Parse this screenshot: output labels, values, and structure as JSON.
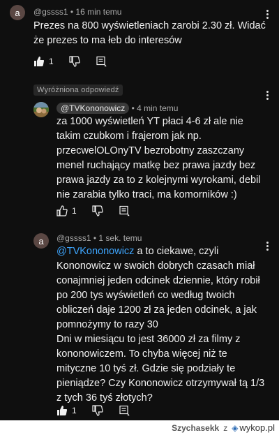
{
  "comment1": {
    "avatar_letter": "a",
    "username": "@gssss1",
    "time": "• 16 min temu",
    "lines": [
      "Prezes na 800 wyświetleniach zarobi 2.30 zł. Widać",
      "że prezes to ma łeb do interesów"
    ],
    "likes": "1"
  },
  "comment2": {
    "badge": "Wyróżniona odpowiedź",
    "username": "@TVKononowicz",
    "time": "• 4 min temu",
    "lines": [
      "za 1000 wyświetleń YT płaci 4-6 zł ale nie",
      "takim czubkom i frajerom jak np.",
      "przecwelOLOnyTV bezrobotny zaszczany",
      "menel ruchający matkę bez prawa jazdy bez",
      "prawa jazdy za to z kolejnymi wyrokami, debil",
      "nie zarabia tylko traci, ma komorników :)"
    ],
    "likes": "1"
  },
  "comment3": {
    "avatar_letter": "a",
    "username": "@gssss1",
    "time": "• 1 sek. temu",
    "mention": "@TVKononowicz",
    "first_line_rest": " a to ciekawe, czyli",
    "lines": [
      "Kononowicz w swoich dobrych czasach miał",
      "conajmniej jeden odcinek dziennie, który robił",
      "po 200 tys wyświetleń co według twoich",
      "obliczeń daje 1200 zł za jeden odcinek, a jak",
      "pomnożymy to razy 30",
      "Dni w miesiącu to jest 36000 zł za filmy z",
      "kononowiczem. To chyba więcej niż te",
      "mityczne 10 tyś zł. Gdzie się podziały te",
      "pieniądze? Czy Kononowicz otrzymywał tą 1/3",
      "z tych 36 tyś złotych?"
    ],
    "likes": "1"
  },
  "footer": {
    "user": "Szychasekk",
    "separator": "z",
    "site": "wykop.pl"
  },
  "colors": {
    "background": "#0f0f0f",
    "mention": "#3ea6ff",
    "avatar": "#5a4743"
  }
}
